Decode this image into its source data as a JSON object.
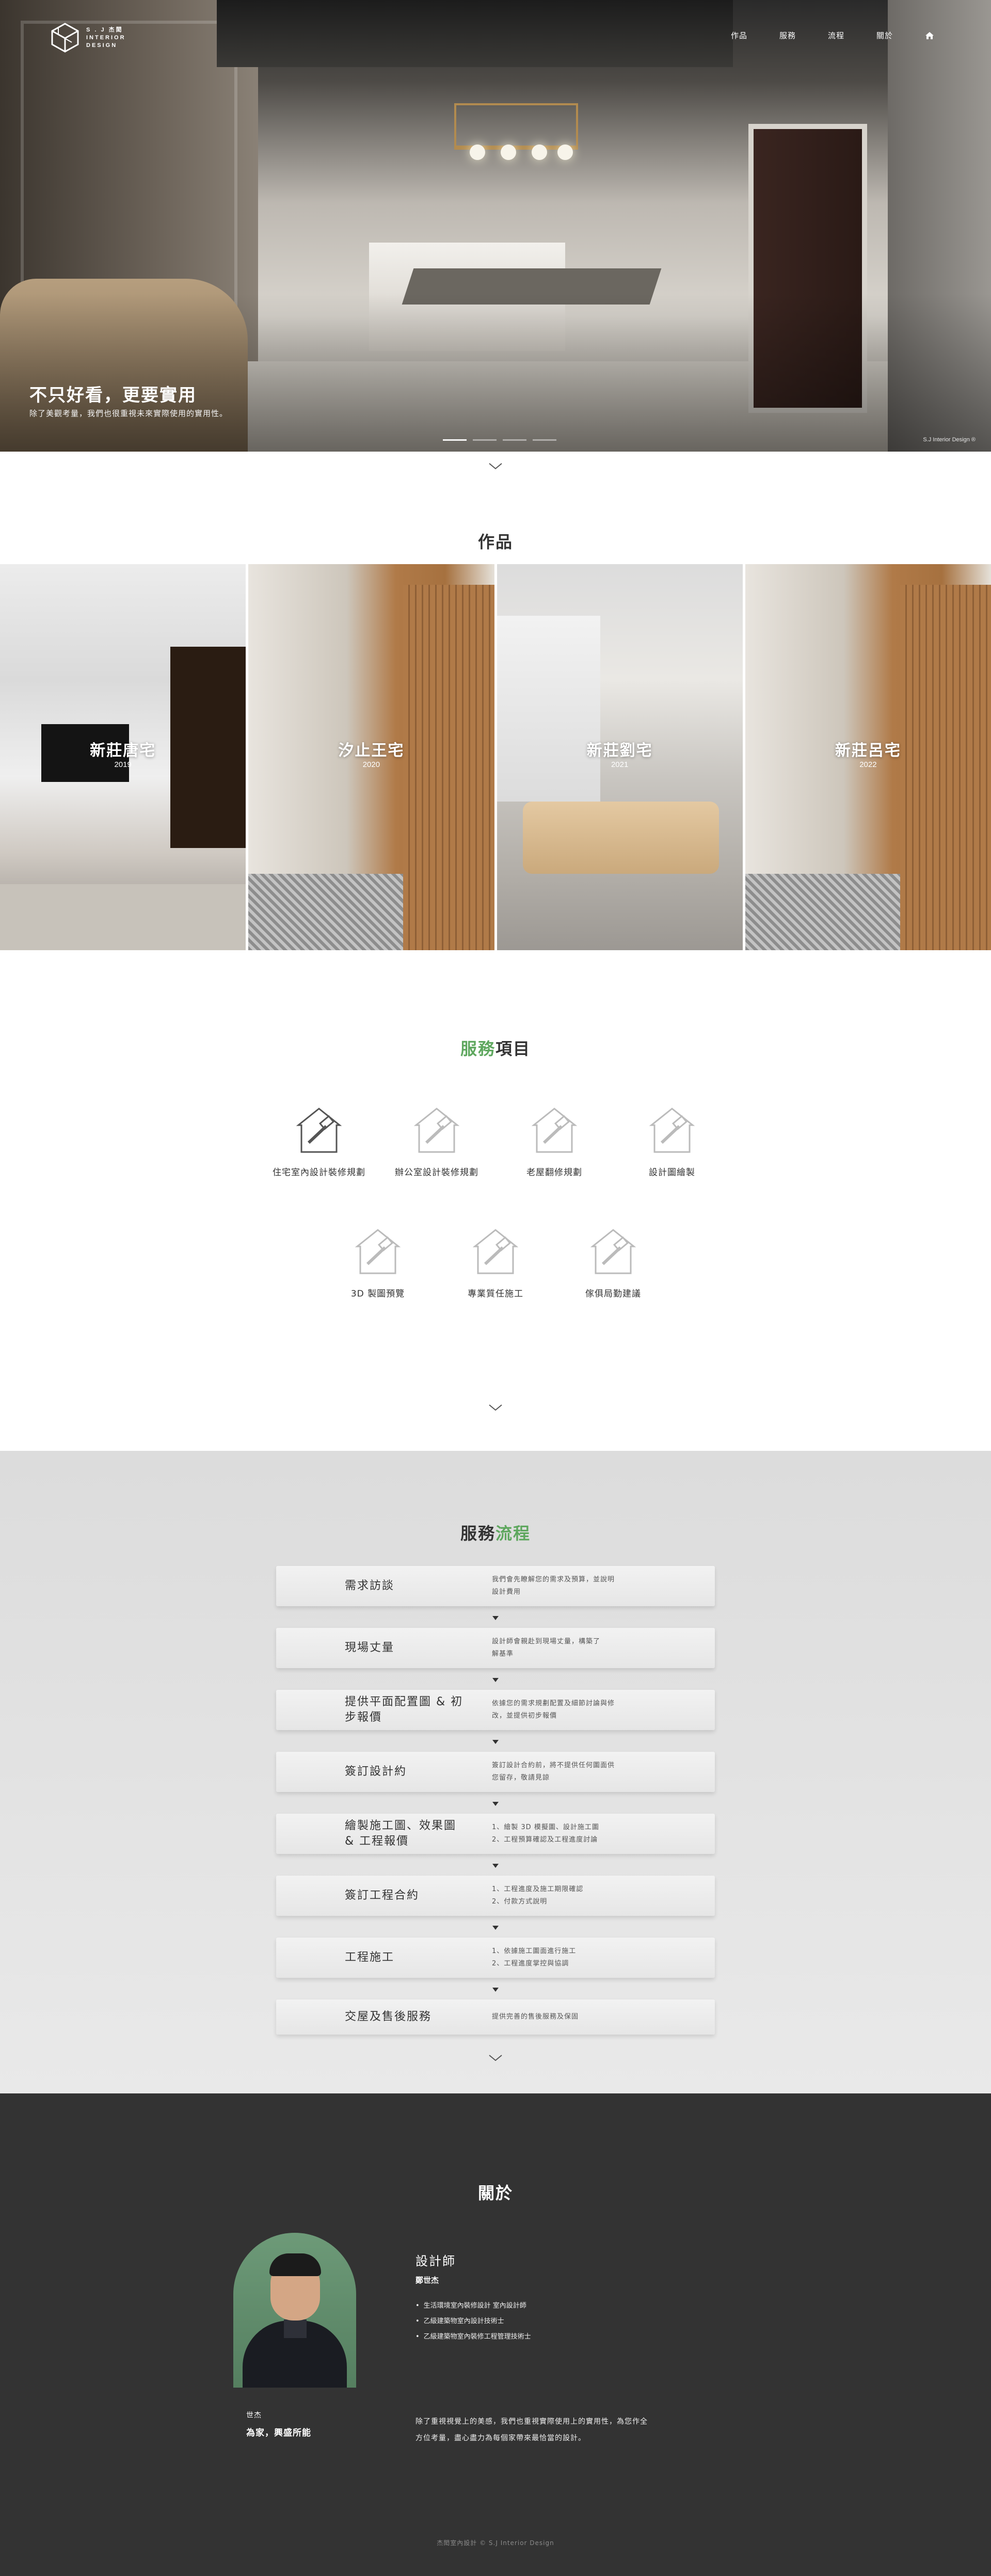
{
  "header": {
    "logo_line1": "S . J  杰閎",
    "logo_line2": "INTERIOR",
    "logo_line3": "DESIGN",
    "nav": [
      "作品",
      "服務",
      "流程",
      "關於"
    ],
    "home_icon": "home-icon"
  },
  "hero": {
    "title": "不只好看，更要實用",
    "subtitle": "除了美觀考量，我們也很重視未來實際使用的實用性。",
    "credit": "S.J Interior Design ®",
    "slides_total": 4,
    "active_slide": 1
  },
  "works": {
    "title": "作品",
    "items": [
      {
        "name": "新莊唐宅",
        "year": "2019"
      },
      {
        "name": "汐止王宅",
        "year": "2020"
      },
      {
        "name": "新莊劉宅",
        "year": "2021"
      },
      {
        "name": "新莊呂宅",
        "year": "2022"
      }
    ]
  },
  "services": {
    "title_accent": "服務",
    "title_rest": "項目",
    "items": [
      "住宅室內設計裝修規劃",
      "辦公室設計裝修規劃",
      "老屋翻修規劃",
      "設計圖繪製",
      "3D 製圖預覽",
      "專業質任施工",
      "傢俱局勤建議"
    ]
  },
  "process": {
    "title_plain": "服務",
    "title_accent": "流程",
    "steps": [
      {
        "title": "需求訪談",
        "desc": [
          "我們會先瞭解您的需求及預算，並說明",
          "設計費用"
        ]
      },
      {
        "title": "現場丈量",
        "desc": [
          "設計師會親赴到現場丈量，構築了",
          "解基準"
        ]
      },
      {
        "title": "提供平面配置圖 & 初步報價",
        "desc": [
          "依據您的需求規劃配置及細節討論與修",
          "改，並提供初步報價"
        ]
      },
      {
        "title": "簽訂設計約",
        "desc": [
          "簽訂設計合約前，將不提供任何圖面供",
          "您留存，敬請見諒"
        ]
      },
      {
        "title": "繪製施工圖、效果圖 & 工程報價",
        "desc": [
          "1、繪製 3D 模擬圖、設計施工圖",
          "2、工程預算確認及工程進度討論"
        ]
      },
      {
        "title": "簽訂工程合約",
        "desc": [
          "1、工程進度及施工期限確認",
          "2、付款方式說明"
        ]
      },
      {
        "title": "工程施工",
        "desc": [
          "1、依據施工圖面進行施工",
          "2、工程進度掌控與協調"
        ]
      },
      {
        "title": "交屋及售後服務",
        "desc": [
          "提供完善的售後服務及保固"
        ]
      }
    ]
  },
  "about": {
    "title": "關於",
    "designer_label": "設計師",
    "designer_name": "鄭世杰",
    "credentials": [
      "生活環境室內裝修設計 室內設計師",
      "乙級建築物室內設計技術士",
      "乙級建築物室內裝修工程管理技術士"
    ],
    "role_line1": "世杰",
    "role_line2": "為家，興盛所能",
    "description": "除了重視視覺上的美感，我們也重視實際使用上的實用性，為您作全方位考量，盡心盡力為每個家帶來最恰當的設計。",
    "footer": "杰閎室內設計 © S.J  Interior Design"
  },
  "colors": {
    "accent": "#5ea75e",
    "about_bg": "#333333",
    "process_bg": "#e2e2e2"
  }
}
